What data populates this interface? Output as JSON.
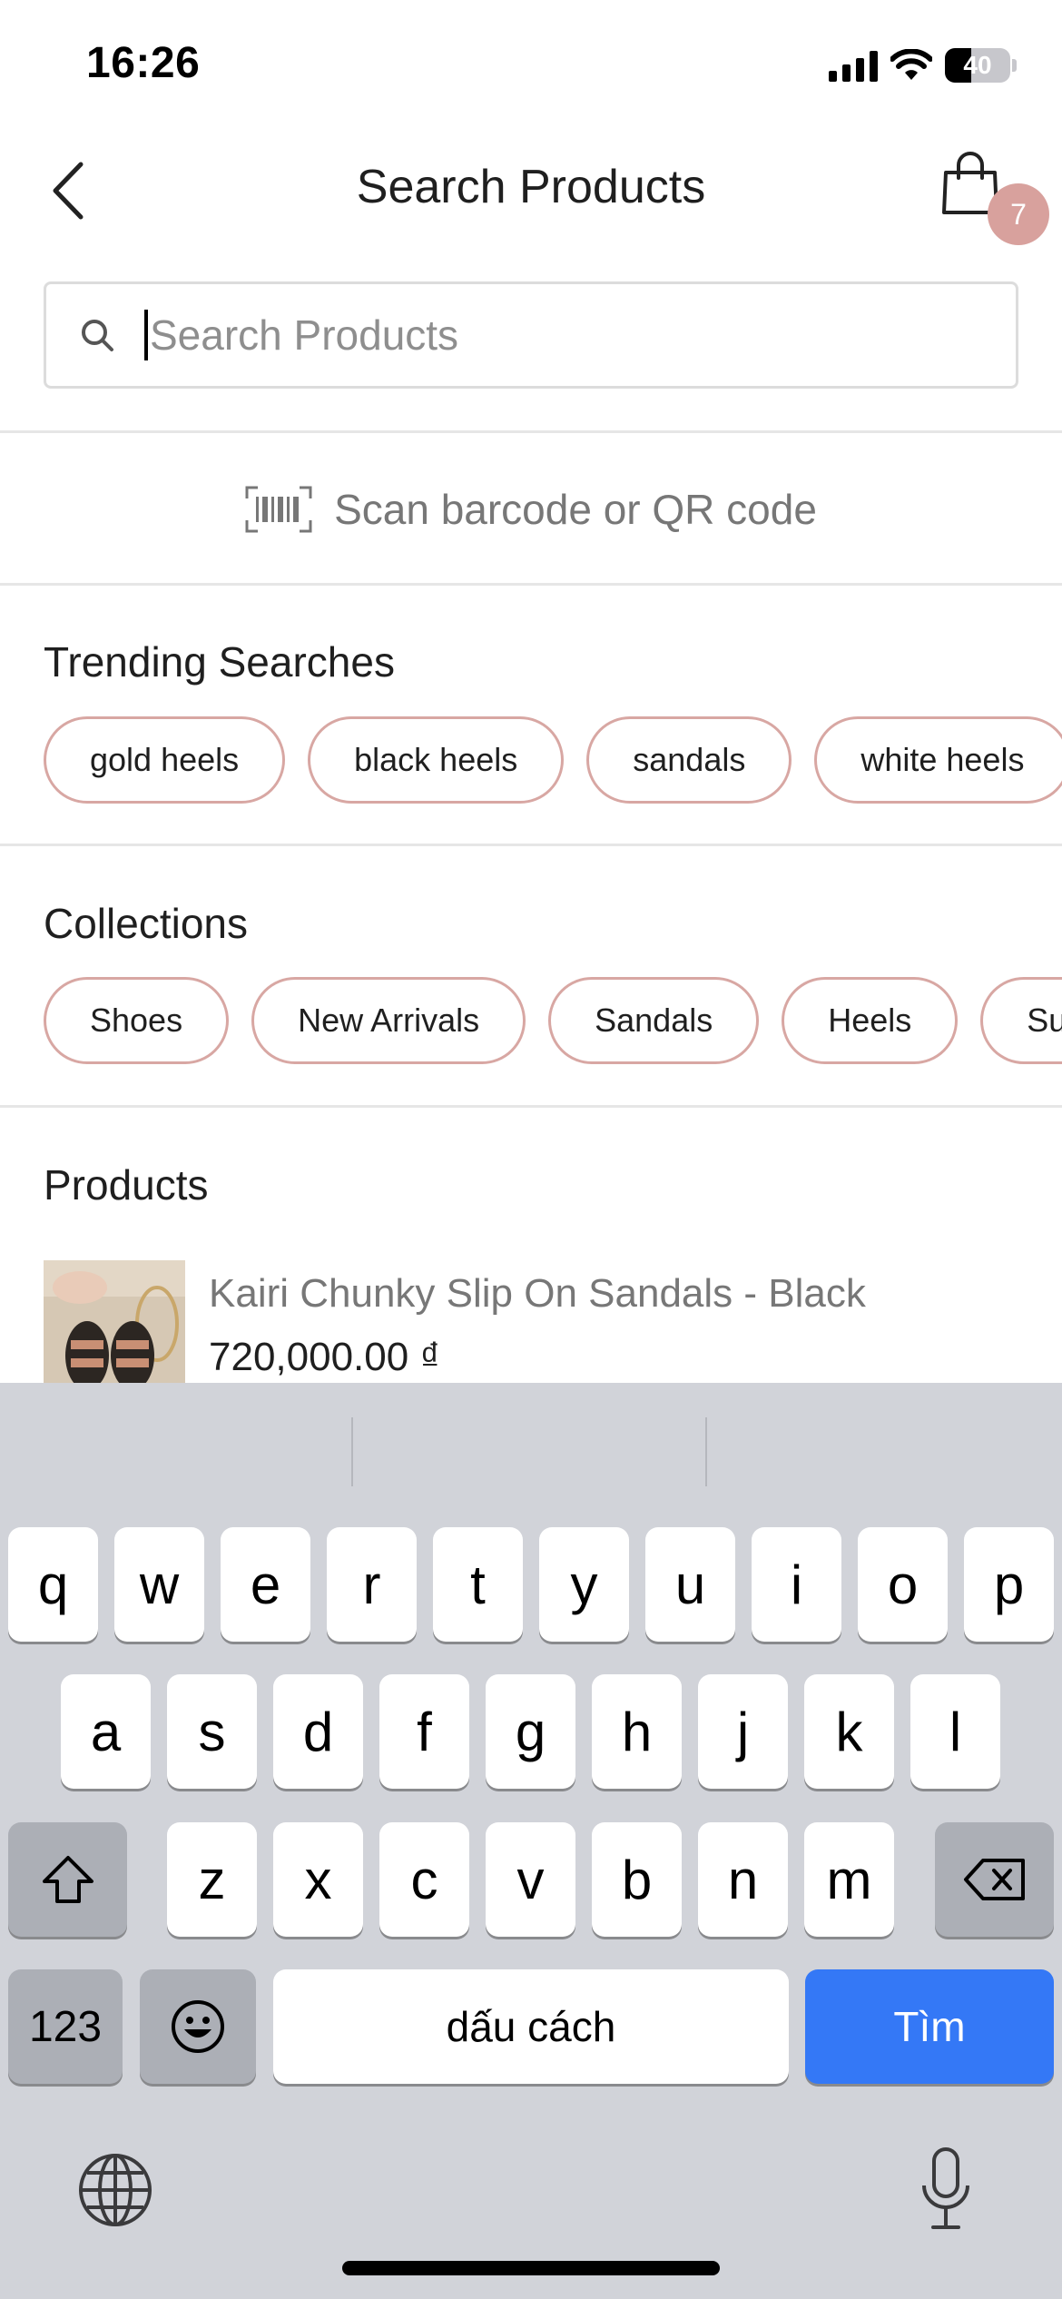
{
  "status_bar": {
    "time": "16:26",
    "battery": "40",
    "battery_level": 0.4
  },
  "header": {
    "title": "Search Products",
    "cart_count": "7"
  },
  "search": {
    "placeholder": "Search Products",
    "value": ""
  },
  "scan": {
    "label": "Scan barcode or QR code"
  },
  "trending": {
    "title": "Trending Searches",
    "items": [
      "gold heels",
      "black heels",
      "sandals",
      "white heels"
    ]
  },
  "collections": {
    "title": "Collections",
    "items": [
      "Shoes",
      "New Arrivals",
      "Sandals",
      "Heels",
      "Su"
    ]
  },
  "products": {
    "title": "Products",
    "items": [
      {
        "name": "Kairi Chunky Slip On Sandals - Black",
        "price": "720,000.00 ₫"
      }
    ]
  },
  "keyboard": {
    "row1": [
      "q",
      "w",
      "e",
      "r",
      "t",
      "y",
      "u",
      "i",
      "o",
      "p"
    ],
    "row2": [
      "a",
      "s",
      "d",
      "f",
      "g",
      "h",
      "j",
      "k",
      "l"
    ],
    "row3": [
      "z",
      "x",
      "c",
      "v",
      "b",
      "n",
      "m"
    ],
    "numbers_label": "123",
    "space_label": "dấu cách",
    "go_label": "Tìm"
  },
  "colors": {
    "accent_chip_border": "#d8a7a3",
    "cart_badge": "#d8a19d",
    "go_key": "#3478f6"
  }
}
